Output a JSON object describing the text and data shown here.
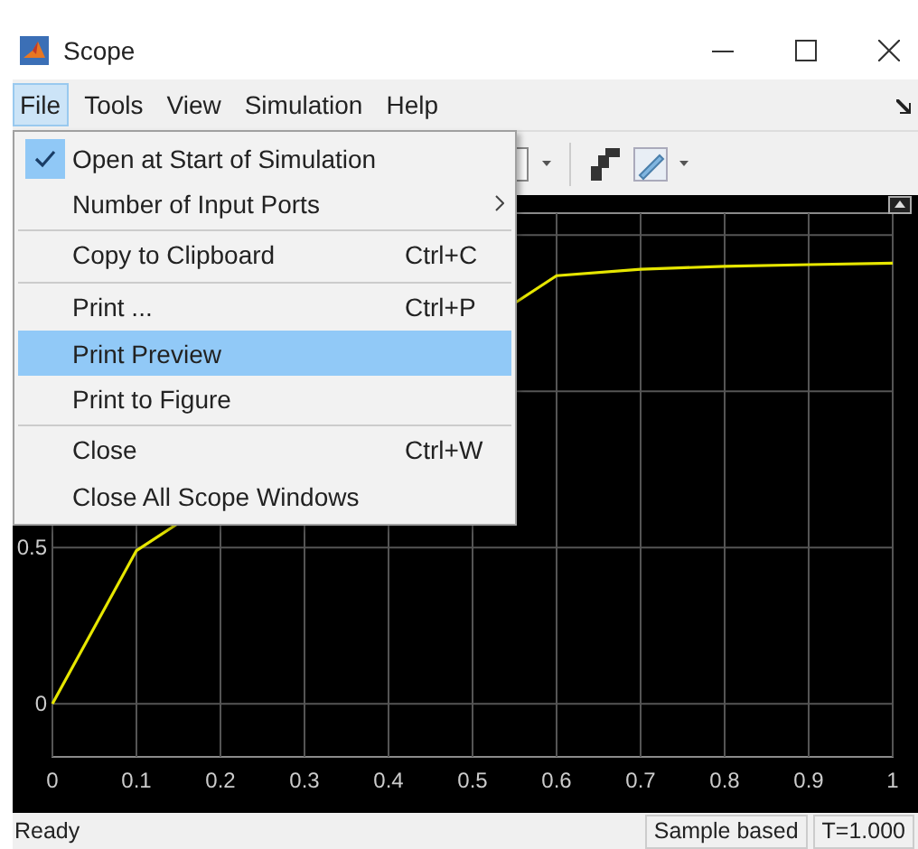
{
  "window": {
    "title": "Scope"
  },
  "menu_bar": [
    {
      "label": "File",
      "selected": true
    },
    {
      "label": "Tools",
      "selected": false
    },
    {
      "label": "View",
      "selected": false
    },
    {
      "label": "Simulation",
      "selected": false
    },
    {
      "label": "Help",
      "selected": false
    }
  ],
  "file_menu": [
    {
      "label": "Open at Start of Simulation",
      "checked": true,
      "selected": false,
      "has_submenu": false,
      "separator_before": false
    },
    {
      "label": "Number of Input Ports",
      "checked": false,
      "selected": false,
      "has_submenu": true,
      "separator_before": false
    },
    {
      "label": "Copy to Clipboard",
      "shortcut": "Ctrl+C",
      "checked": false,
      "selected": false,
      "has_submenu": false,
      "separator_before": true
    },
    {
      "label": "Print ...",
      "shortcut": "Ctrl+P",
      "checked": false,
      "selected": false,
      "has_submenu": false,
      "separator_before": true
    },
    {
      "label": "Print Preview",
      "checked": false,
      "selected": true,
      "has_submenu": false,
      "separator_before": false
    },
    {
      "label": "Print to Figure",
      "checked": false,
      "selected": false,
      "has_submenu": false,
      "separator_before": false
    },
    {
      "label": "Close",
      "shortcut": "Ctrl+W",
      "checked": false,
      "selected": false,
      "has_submenu": false,
      "separator_before": true
    },
    {
      "label": "Close All Scope Windows",
      "checked": false,
      "selected": false,
      "has_submenu": false,
      "separator_before": false
    }
  ],
  "plot": {
    "chart_data": {
      "type": "line",
      "x": [
        0,
        0.1,
        0.6,
        0.7,
        0.8,
        0.9,
        1
      ],
      "series": [
        {
          "color": "#e6e600",
          "values": [
            0,
            0.49,
            1.37,
            1.39,
            1.4,
            1.405,
            1.41
          ]
        }
      ],
      "xlim": [
        0,
        1
      ],
      "ylim": [
        -0.17,
        1.57
      ],
      "xticks": [
        0,
        0.1,
        0.2,
        0.3,
        0.4,
        0.5,
        0.6,
        0.7,
        0.8,
        0.9,
        1
      ],
      "yticks": [
        0,
        0.5
      ],
      "grid": true
    }
  },
  "status_bar": {
    "message": "Ready",
    "mode": "Sample based",
    "time": "T=1.000"
  }
}
